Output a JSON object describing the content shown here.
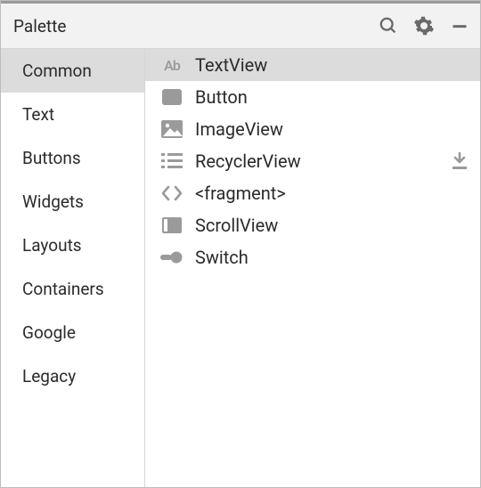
{
  "header": {
    "title": "Palette"
  },
  "sidebar": {
    "items": [
      {
        "label": "Common",
        "name": "sidebar-item-common",
        "selected": true
      },
      {
        "label": "Text",
        "name": "sidebar-item-text",
        "selected": false
      },
      {
        "label": "Buttons",
        "name": "sidebar-item-buttons",
        "selected": false
      },
      {
        "label": "Widgets",
        "name": "sidebar-item-widgets",
        "selected": false
      },
      {
        "label": "Layouts",
        "name": "sidebar-item-layouts",
        "selected": false
      },
      {
        "label": "Containers",
        "name": "sidebar-item-containers",
        "selected": false
      },
      {
        "label": "Google",
        "name": "sidebar-item-google",
        "selected": false
      },
      {
        "label": "Legacy",
        "name": "sidebar-item-legacy",
        "selected": false
      }
    ]
  },
  "components": [
    {
      "label": "TextView",
      "icon": "ab-icon",
      "name": "component-textview",
      "selected": true,
      "download": false
    },
    {
      "label": "Button",
      "icon": "rect-icon",
      "name": "component-button",
      "selected": false,
      "download": false
    },
    {
      "label": "ImageView",
      "icon": "image-icon",
      "name": "component-imageview",
      "selected": false,
      "download": false
    },
    {
      "label": "RecyclerView",
      "icon": "list-icon",
      "name": "component-recyclerview",
      "selected": false,
      "download": true
    },
    {
      "label": "<fragment>",
      "icon": "code-icon",
      "name": "component-fragment",
      "selected": false,
      "download": false
    },
    {
      "label": "ScrollView",
      "icon": "scroll-icon",
      "name": "component-scrollview",
      "selected": false,
      "download": false
    },
    {
      "label": "Switch",
      "icon": "switch-icon",
      "name": "component-switch",
      "selected": false,
      "download": false
    }
  ]
}
